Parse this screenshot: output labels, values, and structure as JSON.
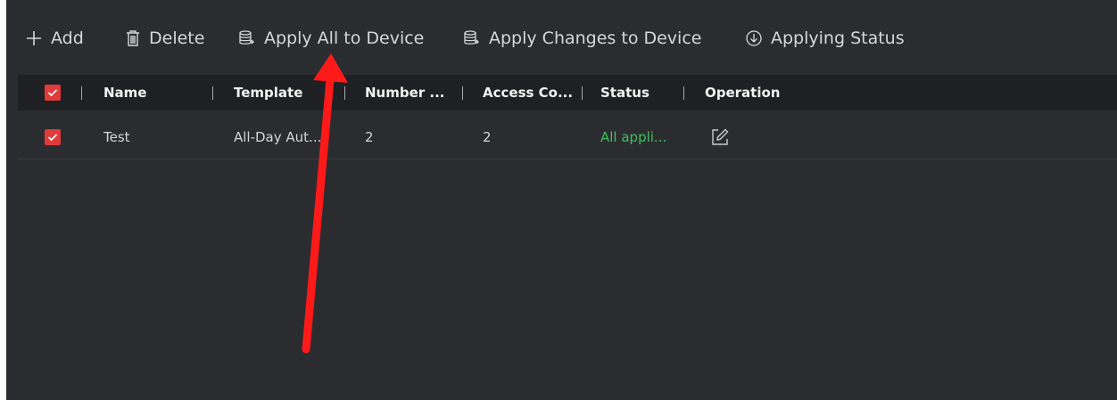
{
  "toolbar": {
    "add_label": "Add",
    "delete_label": "Delete",
    "apply_all_label": "Apply All to Device",
    "apply_changes_label": "Apply Changes to Device",
    "applying_status_label": "Applying Status"
  },
  "table": {
    "columns": [
      "Name",
      "Template",
      "Number ...",
      "Access Co...",
      "Status",
      "Operation"
    ],
    "rows": [
      {
        "selected": true,
        "name": "Test",
        "template": "All-Day Aut...",
        "number": "2",
        "access_control": "2",
        "status": "All appli...",
        "operation_icon": "edit-icon"
      }
    ],
    "header_selected": true
  },
  "colors": {
    "background": "#2b2c30",
    "header_bg": "#1f2023",
    "checkbox": "#e03a3a",
    "status_ok": "#3fc05b",
    "annotation_arrow": "#ff1a1a"
  },
  "icons": [
    "plus-icon",
    "trash-icon",
    "device-apply-icon",
    "device-apply-changes-icon",
    "download-circle-icon",
    "check-icon",
    "edit-icon"
  ]
}
